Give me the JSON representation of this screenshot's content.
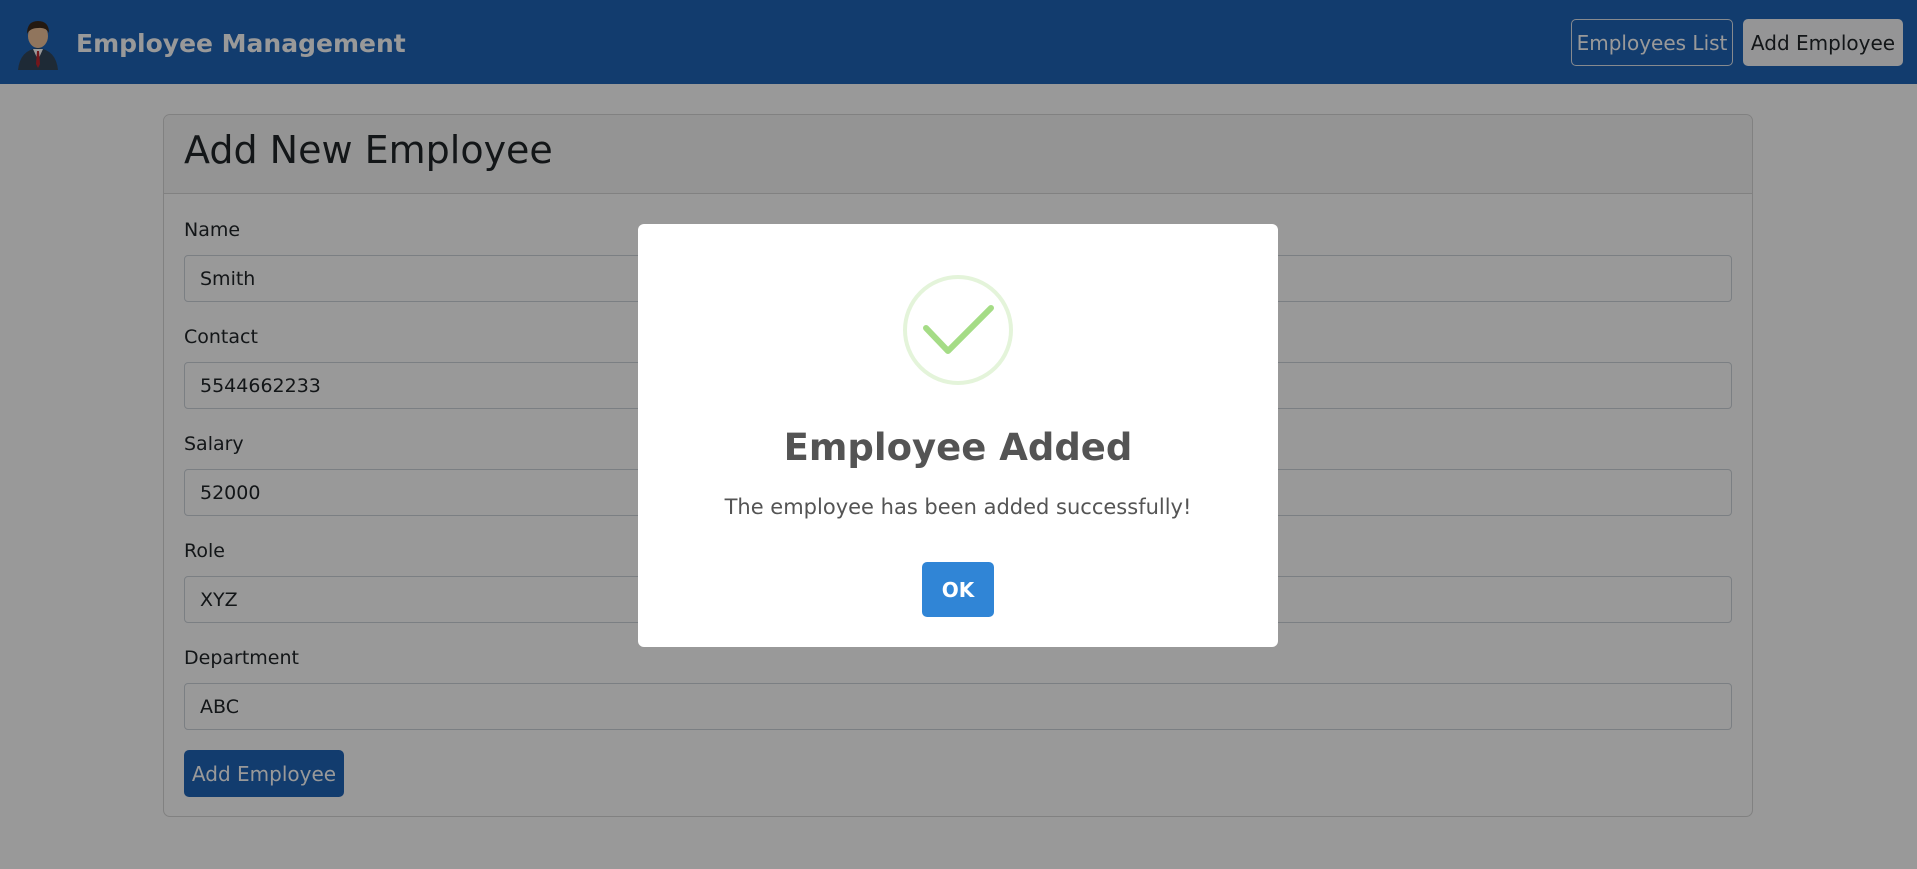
{
  "navbar": {
    "brand_title": "Employee Management",
    "employees_list_label": "Employees List",
    "add_employee_label": "Add Employee"
  },
  "form": {
    "title": "Add New Employee",
    "fields": [
      {
        "label": "Name",
        "value": "Smith"
      },
      {
        "label": "Contact",
        "value": "5544662233"
      },
      {
        "label": "Salary",
        "value": "52000"
      },
      {
        "label": "Role",
        "value": "XYZ"
      },
      {
        "label": "Department",
        "value": "ABC"
      }
    ],
    "submit_label": "Add Employee"
  },
  "modal": {
    "icon": "check-icon",
    "title": "Employee Added",
    "text": "The employee has been added successfully!",
    "ok_label": "OK"
  },
  "colors": {
    "navbar": "#1f64b8",
    "primary_button": "#1f64b8",
    "modal_ok": "#3085d6",
    "success": "#a5dc86"
  }
}
